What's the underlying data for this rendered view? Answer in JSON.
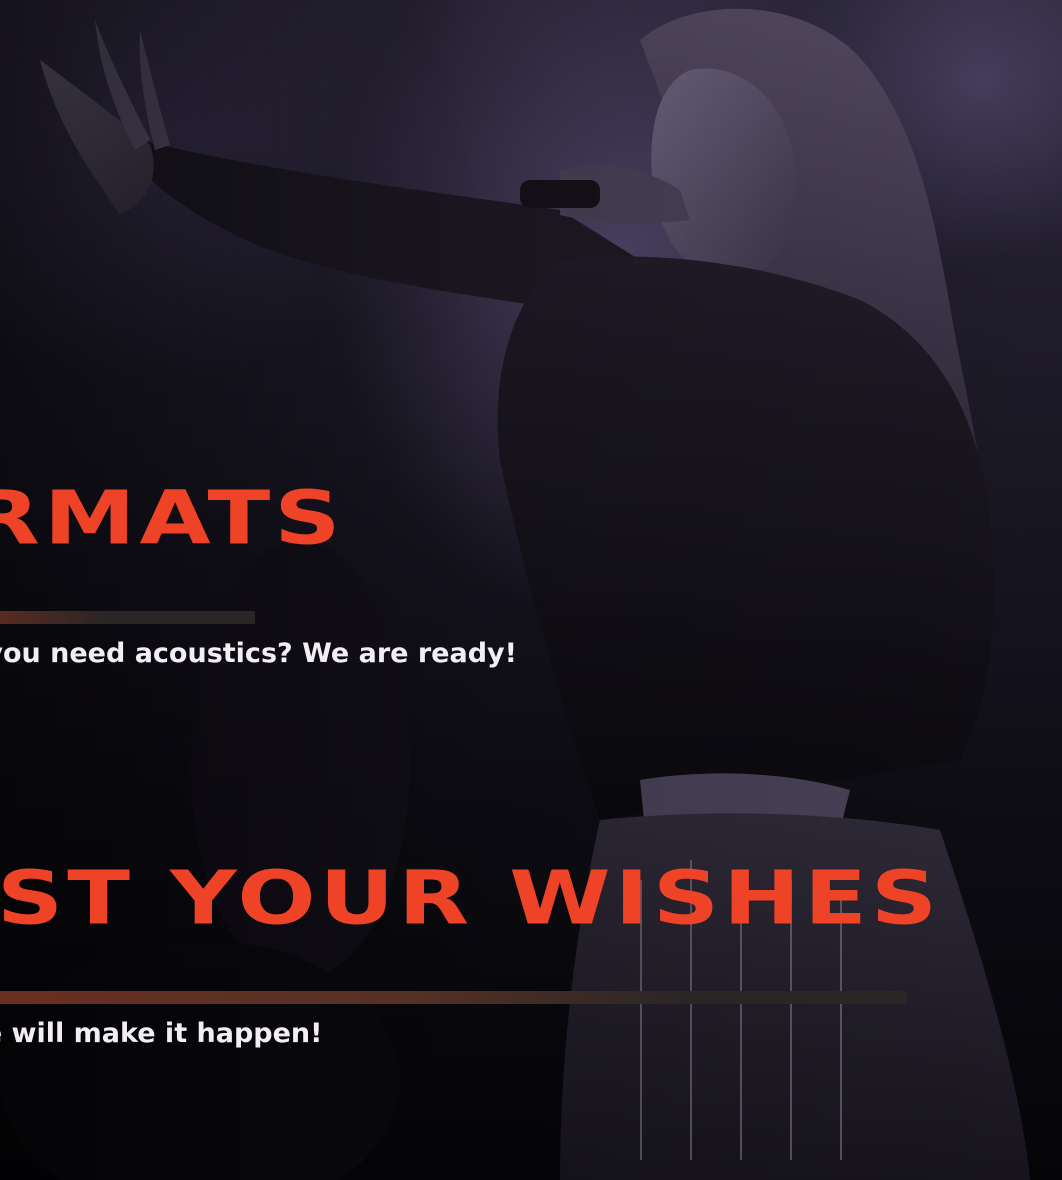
{
  "sections": [
    {
      "heading": "FORMATS",
      "description": "Do you need acoustics? We are ready!"
    },
    {
      "heading": "JUST YOUR WISHES",
      "description": "We will make it happen!"
    }
  ],
  "colors": {
    "accent": "#ee4327",
    "text": "#f2eef4",
    "bar_dark": "#2b2626"
  },
  "background_image": "singer-performing-on-stage"
}
